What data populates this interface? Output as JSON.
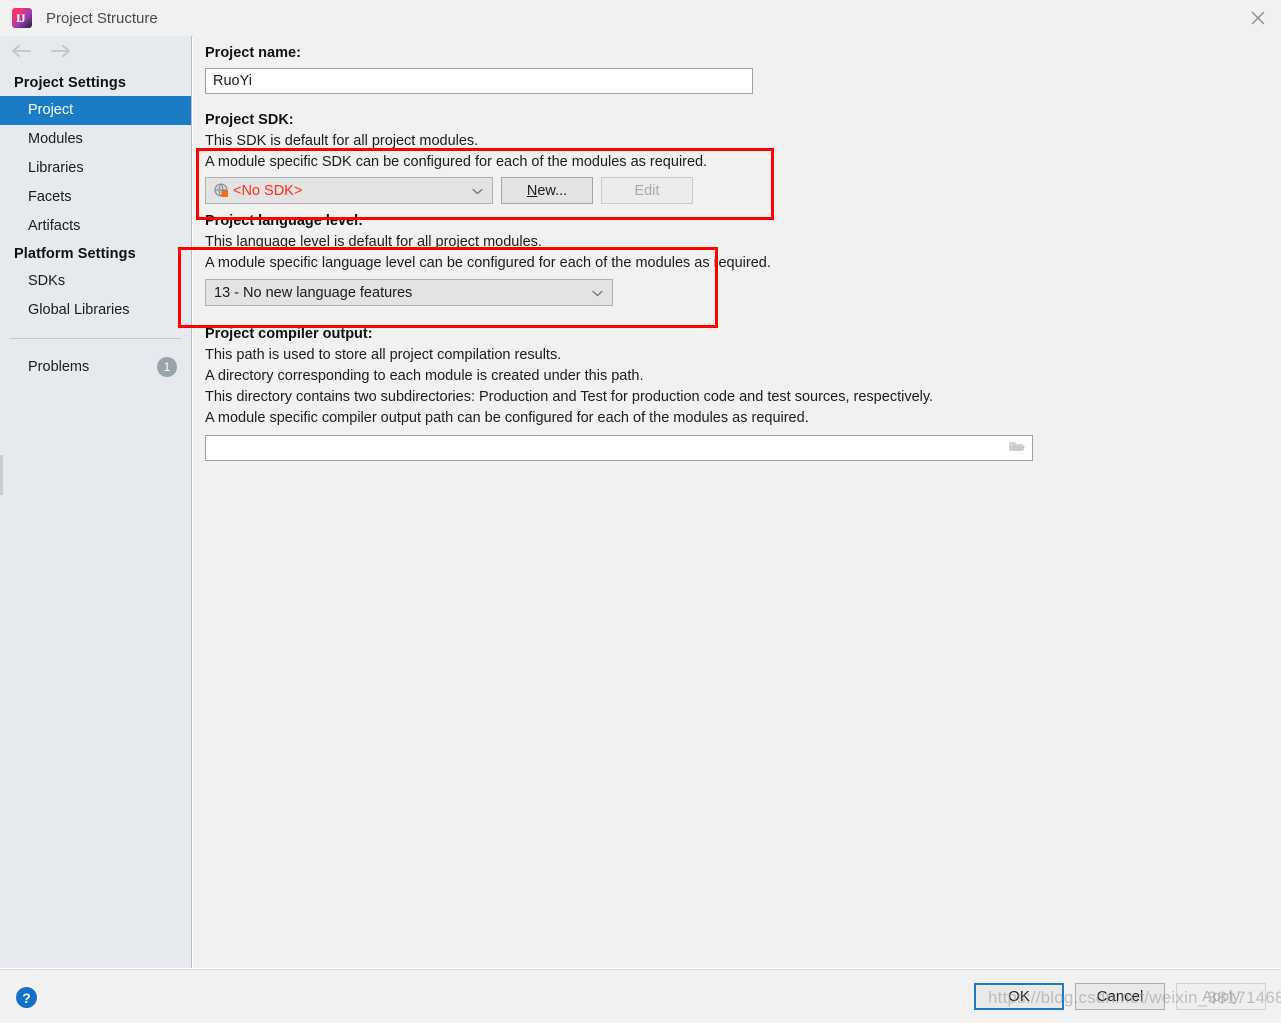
{
  "window": {
    "title": "Project Structure",
    "logo_text": "IJ",
    "close_icon": "close-icon"
  },
  "sidebar": {
    "back_icon": "arrow-left-icon",
    "forward_icon": "arrow-right-icon",
    "groups": [
      {
        "header": "Project Settings",
        "items": [
          {
            "label": "Project",
            "selected": true
          },
          {
            "label": "Modules",
            "selected": false
          },
          {
            "label": "Libraries",
            "selected": false
          },
          {
            "label": "Facets",
            "selected": false
          },
          {
            "label": "Artifacts",
            "selected": false
          }
        ]
      },
      {
        "header": "Platform Settings",
        "items": [
          {
            "label": "SDKs",
            "selected": false
          },
          {
            "label": "Global Libraries",
            "selected": false
          }
        ]
      }
    ],
    "problems": {
      "label": "Problems",
      "count": "1"
    }
  },
  "main": {
    "project_name": {
      "label": "Project name:",
      "value": "RuoYi"
    },
    "project_sdk": {
      "label": "Project SDK:",
      "desc1": "This SDK is default for all project modules.",
      "desc2": "A module specific SDK can be configured for each of the modules as required.",
      "selected": "<No SDK>",
      "selected_color": "#ff2d1f",
      "icon": "sdk-globe-icon",
      "chevron_icon": "chevron-down-icon",
      "new_button": "New...",
      "new_button_mnemonic": "N",
      "new_button_rest": "ew...",
      "edit_button": "Edit",
      "edit_disabled": true
    },
    "language_level": {
      "label": "Project language level:",
      "desc1": "This language level is default for all project modules.",
      "desc2": "A module specific language level can be configured for each of the modules as required.",
      "selected": "13 - No new language features",
      "chevron_icon": "chevron-down-icon"
    },
    "compiler_output": {
      "label": "Project compiler output:",
      "desc1": "This path is used to store all project compilation results.",
      "desc2": "A directory corresponding to each module is created under this path.",
      "desc3": "This directory contains two subdirectories: Production and Test for production code and test sources, respectively.",
      "desc4": "A module specific compiler output path can be configured for each of the modules as required.",
      "value": "",
      "browse_icon": "folder-icon"
    }
  },
  "annotations": {
    "accent_color": "#ff0000",
    "boxes": [
      {
        "name": "sdk-highlight"
      },
      {
        "name": "language-level-highlight"
      }
    ]
  },
  "footer": {
    "help_icon": "help-icon",
    "help_glyph": "?",
    "ok": "OK",
    "cancel": "Cancel",
    "apply": "Apply",
    "apply_disabled": true,
    "watermark": "https://blog.csdn.net/weixin_38171468"
  }
}
